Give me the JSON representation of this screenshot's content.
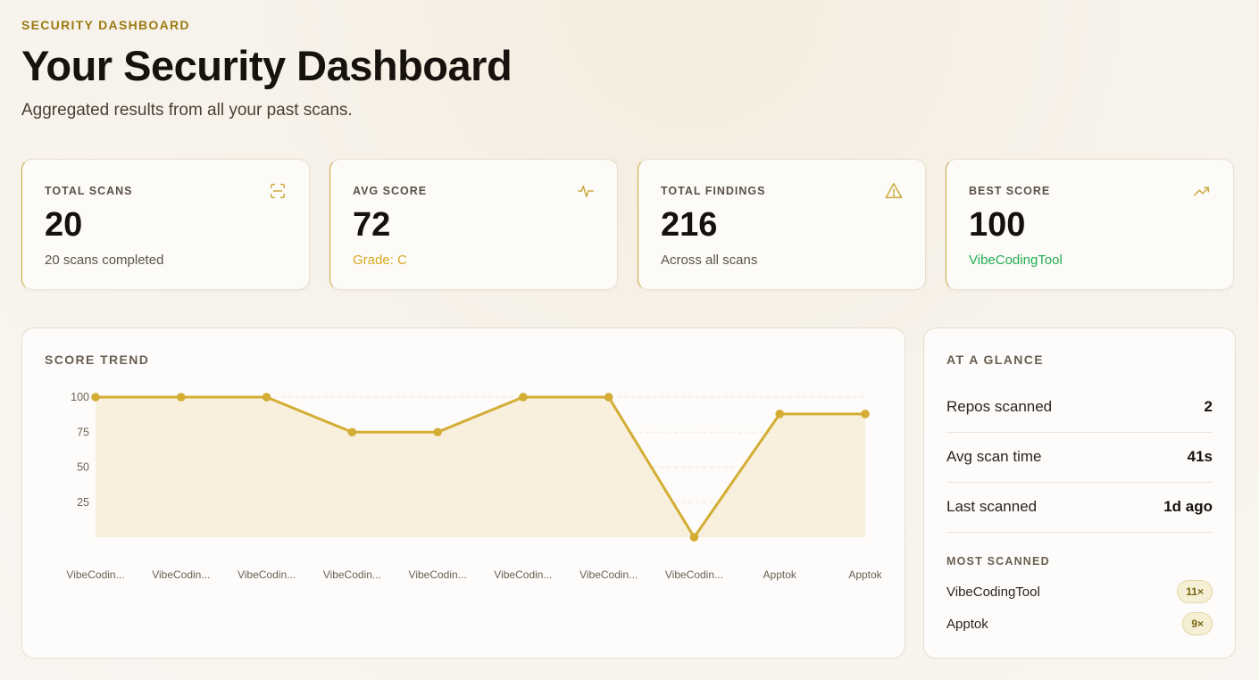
{
  "header": {
    "eyebrow": "SECURITY DASHBOARD",
    "title": "Your Security Dashboard",
    "subtitle": "Aggregated results from all your past scans."
  },
  "stats": {
    "total_scans": {
      "label": "TOTAL SCANS",
      "value": "20",
      "sub": "20 scans completed",
      "icon": "scan-icon"
    },
    "avg_score": {
      "label": "AVG SCORE",
      "value": "72",
      "sub": "Grade: C",
      "icon": "activity-icon",
      "sub_color": "#d6a91f"
    },
    "total_findings": {
      "label": "TOTAL FINDINGS",
      "value": "216",
      "sub": "Across all scans",
      "icon": "warning-icon"
    },
    "best_score": {
      "label": "BEST SCORE",
      "value": "100",
      "sub": "VibeCodingTool",
      "icon": "trending-up-icon",
      "sub_color": "#1fae4f"
    }
  },
  "trend": {
    "title": "SCORE TREND"
  },
  "glance": {
    "title": "AT A GLANCE",
    "rows": [
      {
        "label": "Repos scanned",
        "value": "2"
      },
      {
        "label": "Avg scan time",
        "value": "41s"
      },
      {
        "label": "Last scanned",
        "value": "1d ago"
      }
    ],
    "most_scanned_title": "MOST SCANNED",
    "most_scanned": [
      {
        "name": "VibeCodingTool",
        "count": "11×"
      },
      {
        "name": "Apptok",
        "count": "9×"
      }
    ]
  },
  "colors": {
    "accent": "#d4ad35",
    "eyebrow": "#9a7a12",
    "area_fill": "#f7ecd6"
  },
  "chart_data": {
    "type": "line",
    "title": "SCORE TREND",
    "xlabel": "",
    "ylabel": "",
    "ylim": [
      0,
      100
    ],
    "yticks": [
      25,
      50,
      75,
      100
    ],
    "grid": true,
    "categories": [
      "VibeCodin...",
      "VibeCodin...",
      "VibeCodin...",
      "VibeCodin...",
      "VibeCodin...",
      "VibeCodin...",
      "VibeCodin...",
      "VibeCodin...",
      "Apptok",
      "Apptok"
    ],
    "values": [
      100,
      100,
      100,
      75,
      75,
      100,
      100,
      0,
      88,
      88
    ]
  }
}
